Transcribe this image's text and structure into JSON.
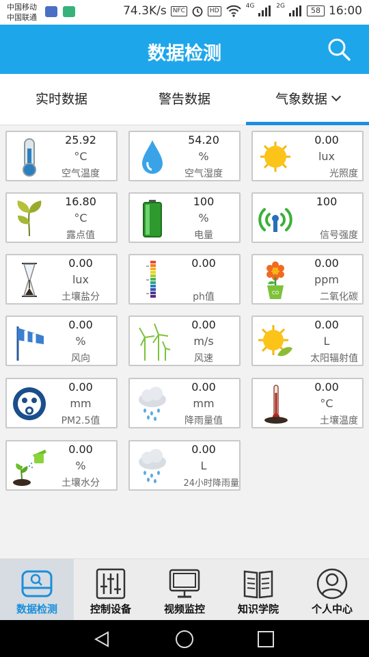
{
  "status": {
    "carrier1": "中国移动",
    "carrier2": "中国联通",
    "speed": "74.3K/s",
    "nfc": "NFC",
    "hd": "HD",
    "net1": "4G",
    "net2": "2G",
    "battery": "58",
    "time": "16:00"
  },
  "header": {
    "title": "数据检测",
    "search_icon": "search-icon",
    "accent": "#1ea6ea"
  },
  "tabs": [
    {
      "label": "实时数据"
    },
    {
      "label": "警告数据"
    },
    {
      "label": "气象数据",
      "selected": true
    }
  ],
  "cards": [
    {
      "name": "air-temperature",
      "icon": "thermometer-icon",
      "value": "25.92",
      "unit": "°C",
      "label": "空气温度"
    },
    {
      "name": "air-humidity",
      "icon": "water-drop-icon",
      "value": "54.20",
      "unit": "%",
      "label": "空气湿度"
    },
    {
      "name": "illuminance",
      "icon": "sun-icon",
      "value": "0.00",
      "unit": "lux",
      "label": "光照度"
    },
    {
      "name": "dew-point",
      "icon": "leaf-icon",
      "value": "16.80",
      "unit": "°C",
      "label": "露点值"
    },
    {
      "name": "battery-level",
      "icon": "battery-icon",
      "value": "100",
      "unit": "%",
      "label": "电量"
    },
    {
      "name": "signal-strength",
      "icon": "signal-icon",
      "value": "100",
      "unit": "",
      "label": "信号强度"
    },
    {
      "name": "soil-salinity",
      "icon": "hourglass-icon",
      "value": "0.00",
      "unit": "lux",
      "label": "土壤盐分"
    },
    {
      "name": "ph-value",
      "icon": "ph-scale-icon",
      "value": "0.00",
      "unit": "",
      "label": "ph值"
    },
    {
      "name": "co2",
      "icon": "co2-flower-icon",
      "value": "0.00",
      "unit": "ppm",
      "label": "二氧化碳"
    },
    {
      "name": "wind-direction",
      "icon": "windsock-icon",
      "value": "0.00",
      "unit": "%",
      "label": "风向"
    },
    {
      "name": "wind-speed",
      "icon": "wind-turbine-icon",
      "value": "0.00",
      "unit": "m/s",
      "label": "风速"
    },
    {
      "name": "solar-radiation",
      "icon": "sun-leaf-icon",
      "value": "0.00",
      "unit": "L",
      "label": "太阳辐射值"
    },
    {
      "name": "pm25",
      "icon": "gas-mask-icon",
      "value": "0.00",
      "unit": "mm",
      "label": "PM2.5值"
    },
    {
      "name": "rainfall",
      "icon": "rain-cloud-icon",
      "value": "0.00",
      "unit": "mm",
      "label": "降雨量值"
    },
    {
      "name": "soil-temperature",
      "icon": "soil-thermometer-icon",
      "value": "0.00",
      "unit": "°C",
      "label": "土壤温度"
    },
    {
      "name": "soil-moisture",
      "icon": "watering-can-icon",
      "value": "0.00",
      "unit": "%",
      "label": "土壤水分"
    },
    {
      "name": "rainfall-24h",
      "icon": "rain-cloud-icon",
      "value": "0.00",
      "unit": "L",
      "label": "24小时降雨量"
    }
  ],
  "nav": [
    {
      "label": "数据检测",
      "icon": "data-monitor-icon",
      "active": true
    },
    {
      "label": "控制设备",
      "icon": "sliders-icon"
    },
    {
      "label": "视频监控",
      "icon": "monitor-icon"
    },
    {
      "label": "知识学院",
      "icon": "book-icon"
    },
    {
      "label": "个人中心",
      "icon": "user-icon"
    }
  ],
  "system_nav": {
    "back": "back-icon",
    "home": "home-icon",
    "recents": "recents-icon"
  }
}
